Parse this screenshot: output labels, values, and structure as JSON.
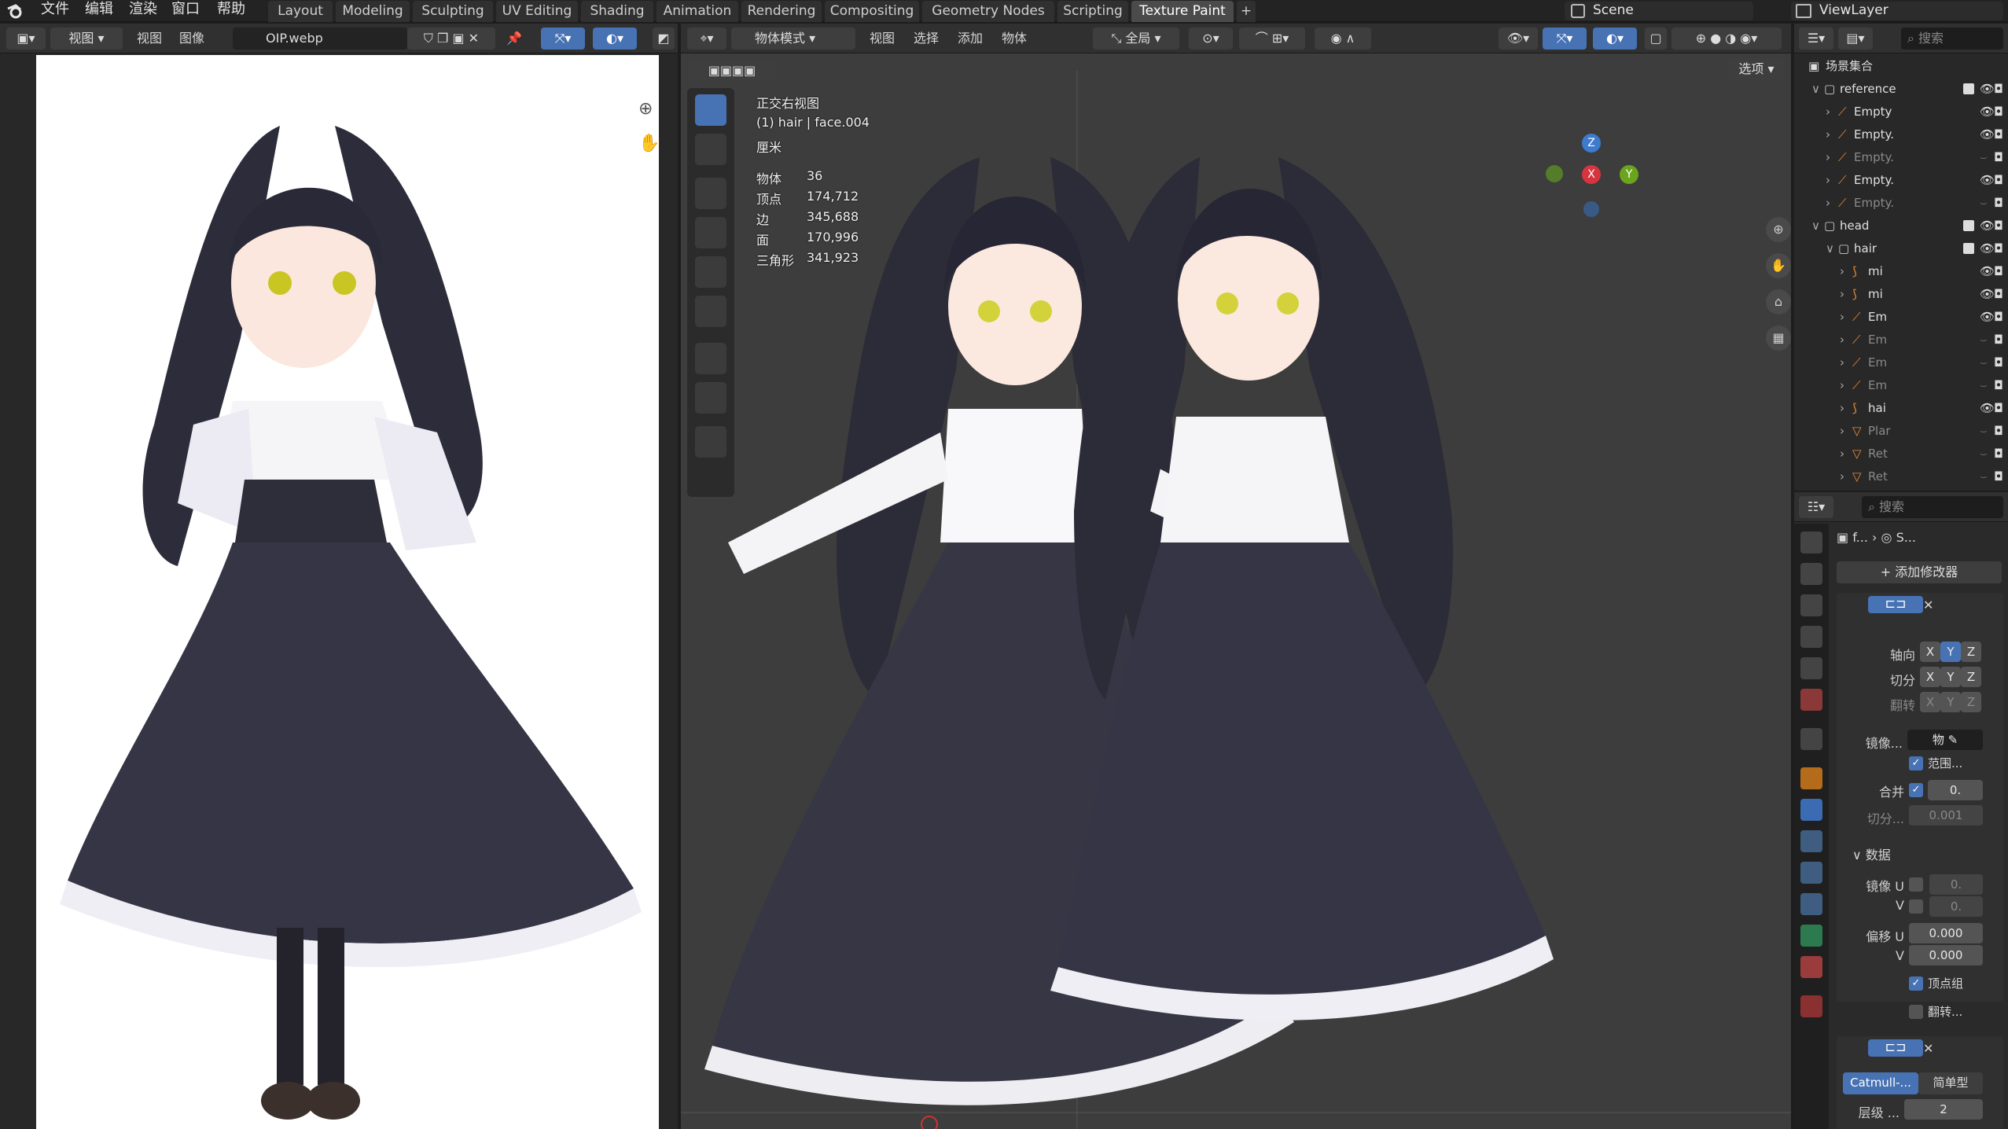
{
  "menus": [
    "文件",
    "编辑",
    "渲染",
    "窗口",
    "帮助"
  ],
  "workspaces": [
    "Layout",
    "Modeling",
    "Sculpting",
    "UV Editing",
    "Shading",
    "Animation",
    "Rendering",
    "Compositing",
    "Geometry Nodes",
    "Scripting",
    "Texture Paint"
  ],
  "active_workspace": "Texture Paint",
  "add_tab": "+",
  "scene": "Scene",
  "view_layer": "ViewLayer",
  "image_editor": {
    "menus": [
      "视图",
      "视图",
      "图像"
    ],
    "image_name": "OIP.webp"
  },
  "viewport": {
    "mode": "物体模式",
    "menus": [
      "视图",
      "选择",
      "添加",
      "物体"
    ],
    "transform": "全局",
    "options": "选项",
    "overlay": {
      "title": "正交右视图",
      "context": "(1) hair | face.004",
      "unit": "厘米",
      "stats": [
        {
          "k": "物体",
          "v": "36"
        },
        {
          "k": "顶点",
          "v": "174,712"
        },
        {
          "k": "边",
          "v": "345,688"
        },
        {
          "k": "面",
          "v": "170,996"
        },
        {
          "k": "三角形",
          "v": "341,923"
        }
      ]
    },
    "gizmo": {
      "z": "Z",
      "x": "X",
      "y": "Y"
    }
  },
  "outliner": {
    "search": "搜索",
    "root": "场景集合",
    "rows": [
      {
        "label": "reference",
        "indent": 1,
        "type": "coll"
      },
      {
        "label": "Empty",
        "indent": 2,
        "type": "empty"
      },
      {
        "label": "Empty.",
        "indent": 2,
        "type": "empty"
      },
      {
        "label": "Empty.",
        "indent": 2,
        "type": "empty",
        "dim": true
      },
      {
        "label": "Empty.",
        "indent": 2,
        "type": "empty"
      },
      {
        "label": "Empty.",
        "indent": 2,
        "type": "empty",
        "dim": true
      },
      {
        "label": "head",
        "indent": 1,
        "type": "coll"
      },
      {
        "label": "hair",
        "indent": 2,
        "type": "coll"
      },
      {
        "label": "mi",
        "indent": 3,
        "type": "curve"
      },
      {
        "label": "mi",
        "indent": 3,
        "type": "curve"
      },
      {
        "label": "Em",
        "indent": 3,
        "type": "empty"
      },
      {
        "label": "Em",
        "indent": 3,
        "type": "empty",
        "dim": true
      },
      {
        "label": "Em",
        "indent": 3,
        "type": "empty",
        "dim": true
      },
      {
        "label": "Em",
        "indent": 3,
        "type": "empty",
        "dim": true
      },
      {
        "label": "hai",
        "indent": 3,
        "type": "curve"
      },
      {
        "label": "Plar",
        "indent": 3,
        "type": "mesh",
        "dim": true
      },
      {
        "label": "Ret",
        "indent": 3,
        "type": "mesh",
        "dim": true
      },
      {
        "label": "Ret",
        "indent": 3,
        "type": "mesh",
        "dim": true
      }
    ]
  },
  "properties": {
    "search": "搜索",
    "breadcrumb": [
      "f...",
      "S..."
    ],
    "add_modifier": "添加修改器",
    "mirror": {
      "axis": "轴向",
      "bisect": "切分",
      "flip": "翻转",
      "xyz": [
        "X",
        "Y",
        "Z"
      ],
      "mirror_obj": "镜像...",
      "mirror_obj_val": "物",
      "clip": "范围...",
      "merge": "合并",
      "merge_val": "0.",
      "bisect_dist": "切分...",
      "bisect_val": "0.001",
      "data": "数据",
      "mirror_u": "镜像 U",
      "v": "V",
      "u_val": "0.",
      "v_val": "0.",
      "offset_u": "偏移 U",
      "off_u_val": "0.000",
      "off_v_val": "0.000",
      "vgroups": "顶点组",
      "flip_udim": "翻转..."
    },
    "subsurf": {
      "type1": "Catmull-...",
      "type2": "简单型",
      "levels": "层级 ...",
      "levels_val": "2"
    }
  },
  "colors": {
    "accent": "#4772b3",
    "bg": "#1d1d1d",
    "header": "#303030",
    "viewport": "#3d3d3d"
  }
}
